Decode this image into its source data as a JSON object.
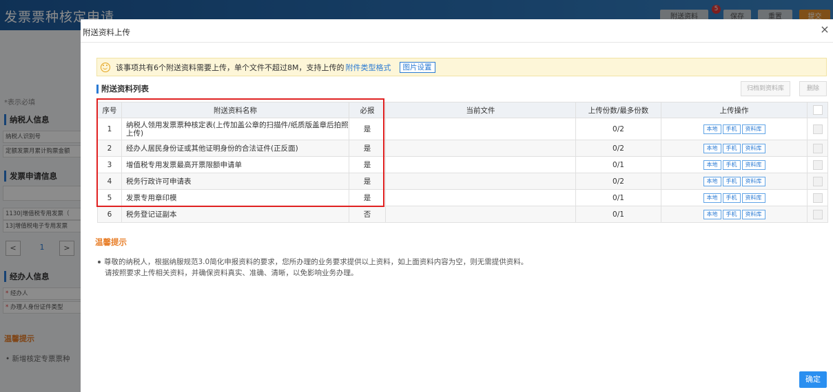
{
  "background": {
    "title": "发票票种核定申请",
    "header_buttons": [
      "附送资料",
      "保存",
      "重置",
      "提交"
    ],
    "header_badge": "5",
    "required_note": "*表示必填",
    "sections": {
      "taxpayer_title": "纳税人信息",
      "taxpayer_rows": [
        "纳税人识别号",
        "定额发票月累计购票金额"
      ],
      "invoice_title": "发票申请信息",
      "invoice_rows": [
        "1130|增值税专用发票（",
        "13|增值税电子专用发票"
      ],
      "pager_prev": "<",
      "pager_page": "1",
      "pager_next": ">",
      "agent_title": "经办人信息",
      "agent_rows": [
        "经办人",
        "办理人身份证件类型"
      ],
      "tips_title": "温馨提示",
      "tips_item": "新增核定专票票种"
    }
  },
  "modal": {
    "title": "附送资料上传",
    "close": "×",
    "notice": {
      "text": "该事项共有6个附送资料需要上传，单个文件不超过8M，支持上传的",
      "link": "附件类型格式",
      "button": "图片设置"
    },
    "list_title": "附送资料列表",
    "btn_archive": "归档到资料库",
    "btn_delete": "删除",
    "columns": [
      "序号",
      "附送资料名称",
      "必报",
      "当前文件",
      "上传份数/最多份数",
      "上传操作"
    ],
    "op_buttons": [
      "本地",
      "手机",
      "资料库"
    ],
    "rows": [
      {
        "no": "1",
        "name": "纳税人领用发票票种核定表(上传加盖公章的扫描件/纸质版盖章后拍照上传)",
        "required": "是",
        "file": "",
        "count": "0/2"
      },
      {
        "no": "2",
        "name": "经办人居民身份证或其他证明身份的合法证件(正反面)",
        "required": "是",
        "file": "",
        "count": "0/2"
      },
      {
        "no": "3",
        "name": "增值税专用发票最高开票限额申请单",
        "required": "是",
        "file": "",
        "count": "0/1"
      },
      {
        "no": "4",
        "name": "税务行政许可申请表",
        "required": "是",
        "file": "",
        "count": "0/2"
      },
      {
        "no": "5",
        "name": "发票专用章印模",
        "required": "是",
        "file": "",
        "count": "0/1"
      },
      {
        "no": "6",
        "name": "税务登记证副本",
        "required": "否",
        "file": "",
        "count": "0/1"
      }
    ],
    "tips_title": "温馨提示",
    "tips_line1": "尊敬的纳税人，根据纳服规范3.0简化申报资料的要求，您所办理的业务要求提供以上资料，如上面资料内容为空，则无需提供资料。",
    "tips_line2": "请按照要求上传相关资料，并确保资料真实、准确、清晰，以免影响业务办理。",
    "confirm": "确定",
    "colors": {
      "accent": "#2a8ff0",
      "highlight": "#e02020",
      "tips": "#e8802c"
    }
  }
}
